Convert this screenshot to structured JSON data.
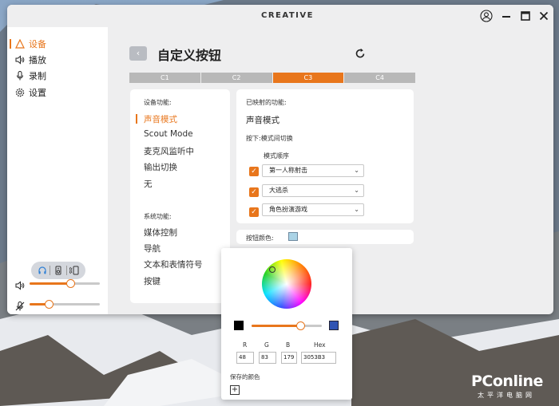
{
  "titlebar": {
    "brand": "CREATIVE",
    "icons": [
      "account-icon",
      "minimize-icon",
      "maximize-icon",
      "close-icon"
    ]
  },
  "sidebar": {
    "items": [
      {
        "label": "设备",
        "icon": "headset-icon",
        "active": true
      },
      {
        "label": "播放",
        "icon": "speaker-icon",
        "active": false
      },
      {
        "label": "录制",
        "icon": "mic-icon",
        "active": false
      },
      {
        "label": "设置",
        "icon": "gear-icon",
        "active": false
      }
    ],
    "mode_icons": [
      "headphone-mode-icon",
      "speaker-mode-icon",
      "surround-mode-icon"
    ],
    "volume_level": 0.58,
    "mic_level": 0.27
  },
  "header": {
    "title": "自定义按钮",
    "tabs": [
      {
        "label": "C1",
        "active": false
      },
      {
        "label": "C2",
        "active": false
      },
      {
        "label": "C3",
        "active": true
      },
      {
        "label": "C4",
        "active": false
      }
    ]
  },
  "functions": {
    "device_label": "设备功能:",
    "device_items": [
      "声音模式",
      "Scout Mode",
      "麦克风监听中",
      "输出切换",
      "无"
    ],
    "system_label": "系统功能:",
    "system_items": [
      "媒体控制",
      "导航",
      "文本和表情符号",
      "按键"
    ]
  },
  "mapping": {
    "mapped_label": "已映射的功能:",
    "mapped_value": "声音模式",
    "press_label": "按下:",
    "press_value": "模式间切换",
    "order_label": "模式顺序",
    "modes": [
      "第一人称射击",
      "大逃杀",
      "角色扮演游戏"
    ]
  },
  "button_color": {
    "label": "按钮颜色:",
    "swatch": "#aad3e6"
  },
  "picker": {
    "r_label": "R",
    "g_label": "G",
    "b_label": "B",
    "hex_label": "Hex",
    "r": "48",
    "g": "83",
    "b": "179",
    "hex": "3053B3",
    "saved_label": "保存的颜色",
    "brightness": 0.69
  },
  "colors": {
    "accent": "#e8761c",
    "selected_color": "#3053b3"
  },
  "watermark": {
    "main": "PConline",
    "sub": "太平洋电脑网"
  }
}
